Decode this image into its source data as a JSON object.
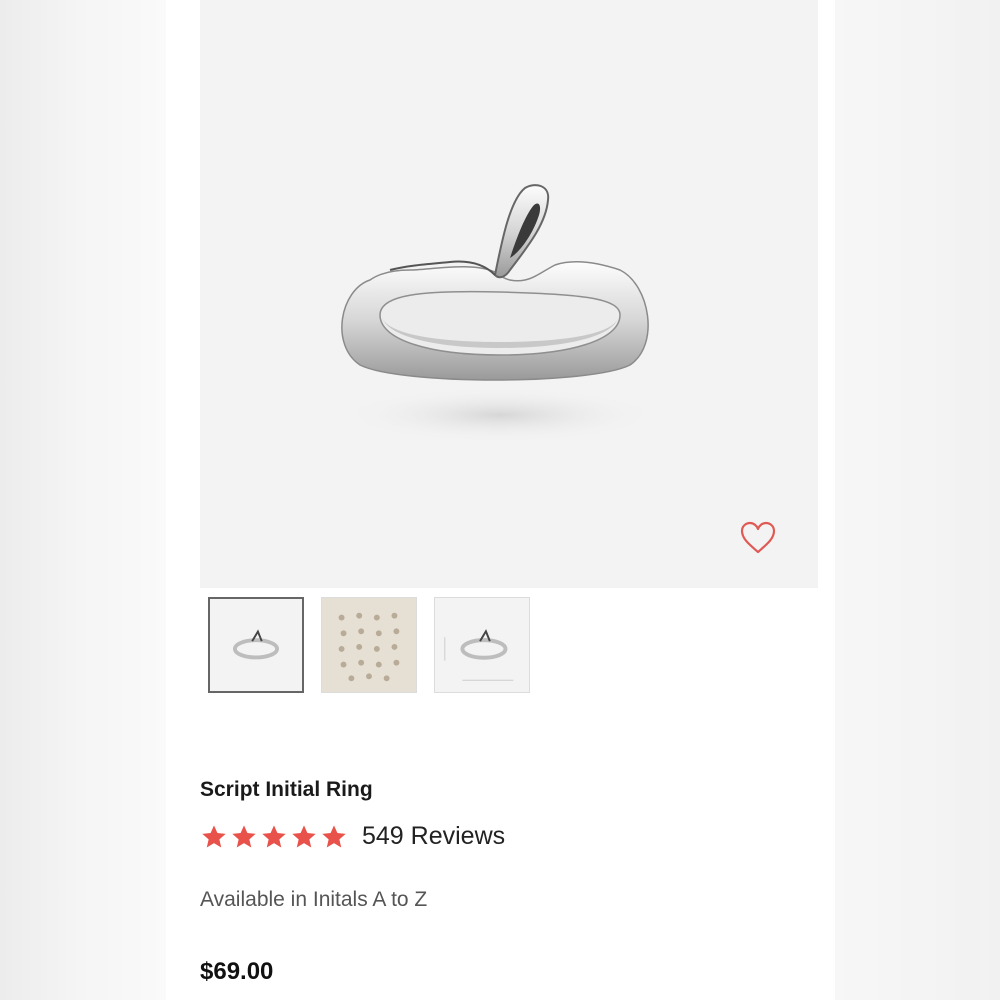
{
  "product": {
    "title": "Script Initial Ring",
    "rating": 5,
    "reviews_label": "549 Reviews",
    "availability": "Available in Initals A to Z",
    "price": "$69.00"
  },
  "gallery": {
    "thumbnails": [
      {
        "id": "thumb-1",
        "selected": true
      },
      {
        "id": "thumb-2",
        "selected": false
      },
      {
        "id": "thumb-3",
        "selected": false
      }
    ]
  },
  "icons": {
    "wishlist": "heart-outline-icon",
    "star": "star-icon"
  },
  "colors": {
    "star": "#e8524a",
    "heart": "#e05a55",
    "title": "#1a1a1a",
    "muted": "#555555",
    "image_bg": "#f3f3f3"
  }
}
